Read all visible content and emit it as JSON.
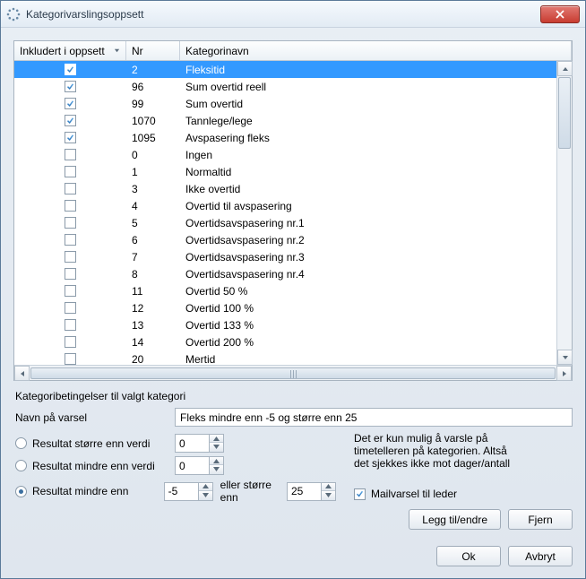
{
  "window": {
    "title": "Kategorivarslingsoppsett"
  },
  "columns": {
    "included": "Inkludert i oppsett",
    "nr": "Nr",
    "name": "Kategorinavn"
  },
  "rows": [
    {
      "included": true,
      "nr": "2",
      "name": "Fleksitid",
      "selected": true
    },
    {
      "included": true,
      "nr": "96",
      "name": "Sum overtid reell"
    },
    {
      "included": true,
      "nr": "99",
      "name": "Sum overtid"
    },
    {
      "included": true,
      "nr": "1070",
      "name": "Tannlege/lege"
    },
    {
      "included": true,
      "nr": "1095",
      "name": "Avspasering fleks"
    },
    {
      "included": false,
      "nr": "0",
      "name": "Ingen"
    },
    {
      "included": false,
      "nr": "1",
      "name": "Normaltid"
    },
    {
      "included": false,
      "nr": "3",
      "name": "Ikke overtid"
    },
    {
      "included": false,
      "nr": "4",
      "name": "Overtid til avspasering"
    },
    {
      "included": false,
      "nr": "5",
      "name": "Overtidsavspasering nr.1"
    },
    {
      "included": false,
      "nr": "6",
      "name": "Overtidsavspasering nr.2"
    },
    {
      "included": false,
      "nr": "7",
      "name": "Overtidsavspasering nr.3"
    },
    {
      "included": false,
      "nr": "8",
      "name": "Overtidsavspasering nr.4"
    },
    {
      "included": false,
      "nr": "11",
      "name": "Overtid 50 %"
    },
    {
      "included": false,
      "nr": "12",
      "name": "Overtid 100 %"
    },
    {
      "included": false,
      "nr": "13",
      "name": "Overtid 133 %"
    },
    {
      "included": false,
      "nr": "14",
      "name": "Overtid 200 %"
    },
    {
      "included": false,
      "nr": "20",
      "name": "Mertid"
    }
  ],
  "section": {
    "heading": "Kategoribetingelser til valgt kategori"
  },
  "form": {
    "name_label": "Navn på varsel",
    "name_value": "Fleks mindre enn -5 og større enn 25",
    "radio_gt": "Resultat større enn verdi",
    "radio_lt": "Resultat mindre enn verdi",
    "radio_range": "Resultat mindre enn",
    "range_or_gt": "eller større enn",
    "gt_value": "0",
    "lt_value": "0",
    "range_low": "-5",
    "range_high": "25",
    "info": "Det er kun mulig å varsle på timetelleren på kategorien. Altså det sjekkes ikke mot dager/antall",
    "mail_label": "Mailvarsel til leder",
    "mail_checked": true,
    "selected_radio": "range"
  },
  "buttons": {
    "add": "Legg til/endre",
    "remove": "Fjern",
    "ok": "Ok",
    "cancel": "Avbryt"
  }
}
